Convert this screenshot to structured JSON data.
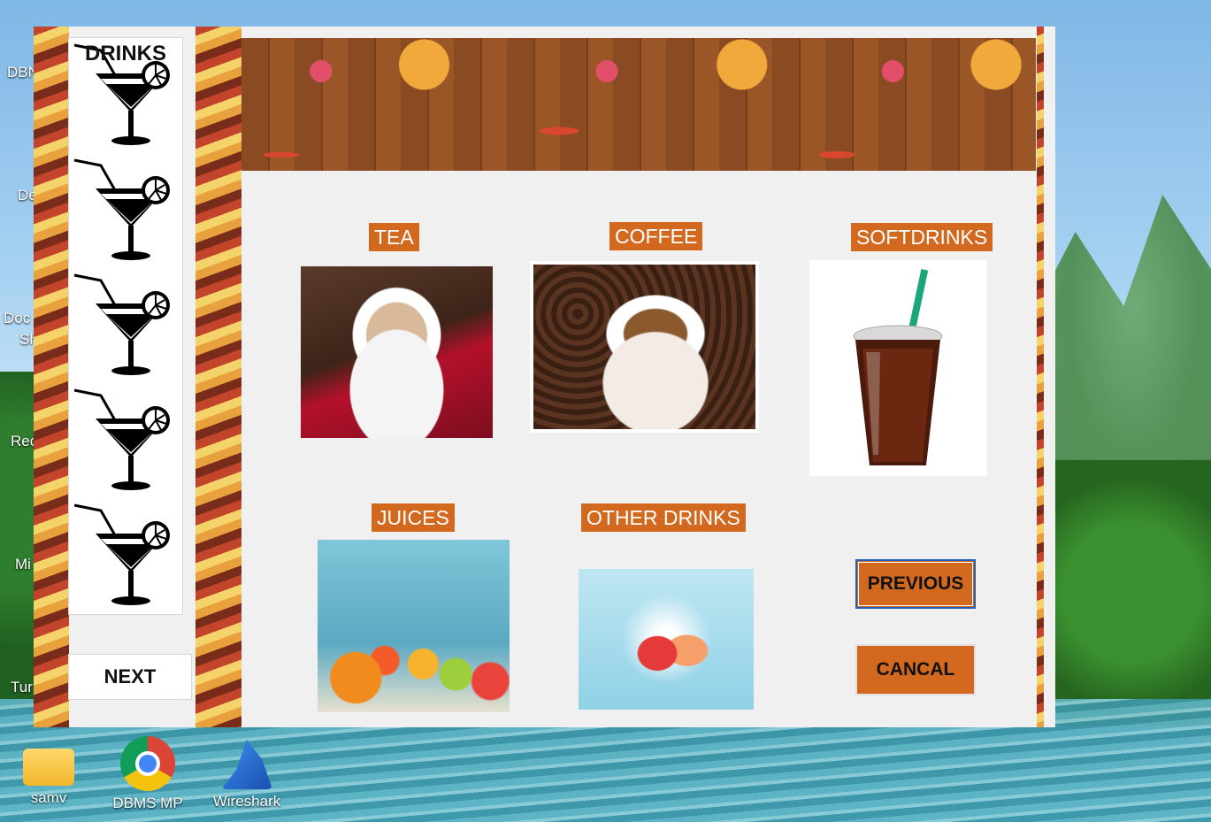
{
  "desktop": {
    "icons": [
      {
        "label": "samv",
        "icon": "folder-icon"
      },
      {
        "label": "DBMS MP",
        "icon": "chrome-icon"
      },
      {
        "label": "Wireshark",
        "icon": "wireshark-icon"
      }
    ],
    "partial_labels": [
      "DBN",
      "De",
      "Doc",
      "Sh",
      "Rec",
      "Mi",
      "Tur"
    ]
  },
  "sidebar": {
    "title": "DRINKS",
    "icon": "cocktail-glass-icon",
    "next_label": "NEXT"
  },
  "categories": [
    {
      "key": "tea",
      "label": "TEA",
      "image": "tea-cup-image"
    },
    {
      "key": "coffee",
      "label": "COFFEE",
      "image": "latte-cup-image"
    },
    {
      "key": "softdrinks",
      "label": "SOFTDRINKS",
      "image": "cola-cup-image"
    },
    {
      "key": "juices",
      "label": "JUICES",
      "image": "juices-fruits-image"
    },
    {
      "key": "other",
      "label": "OTHER DRINKS",
      "image": "splash-drinks-image"
    }
  ],
  "actions": {
    "previous_label": "PREVIOUS",
    "cancel_label": "CANCAL"
  },
  "colors": {
    "accent": "#d2691e",
    "window_bg": "#f0f0f0",
    "focus_border": "#1e5fbf"
  }
}
